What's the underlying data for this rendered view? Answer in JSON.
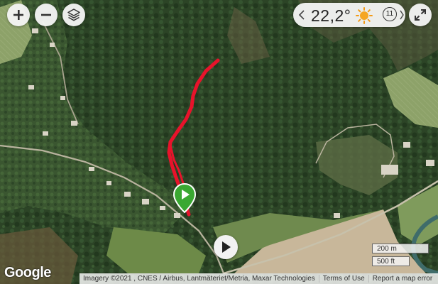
{
  "weather": {
    "temperature": "22,2°",
    "uv_index": "11",
    "icon": "sun-icon"
  },
  "map": {
    "logo": "Google",
    "attribution": "Imagery ©2021 , CNES / Airbus, Lantmäteriet/Metria, Maxar Technologies",
    "terms": "Terms of Use",
    "report": "Report a map error",
    "scale_metric": "200 m",
    "scale_imperial": "500 ft"
  },
  "colors": {
    "route": "#e8132b",
    "start_marker": "#3aa832"
  }
}
